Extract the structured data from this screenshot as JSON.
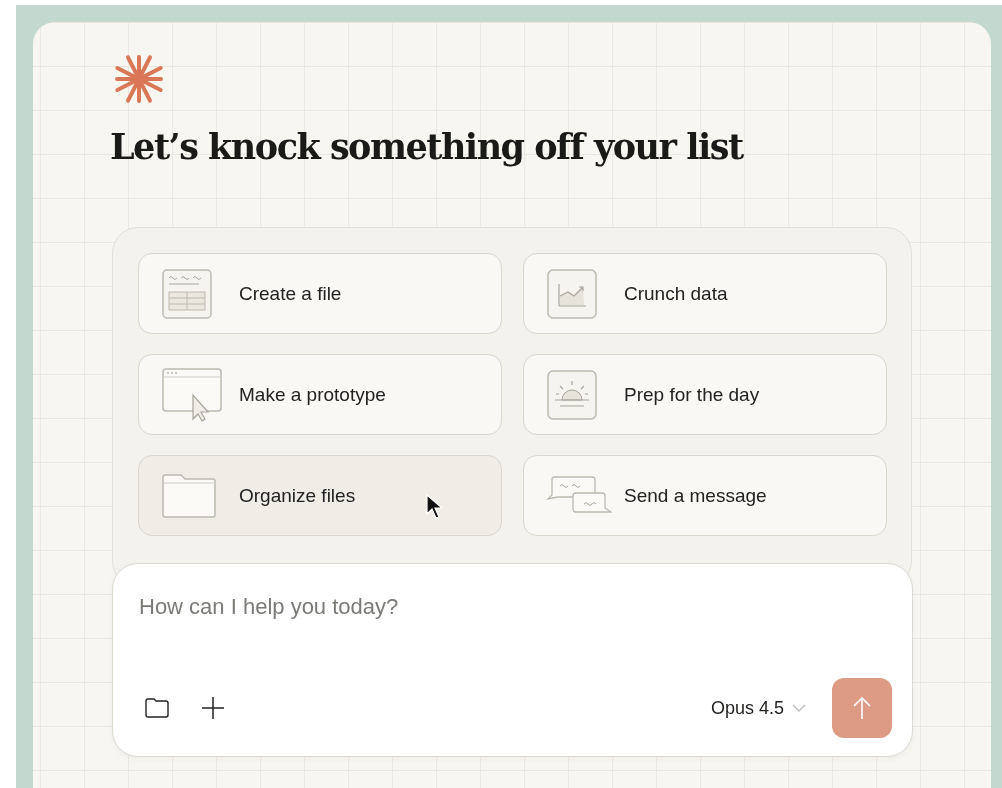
{
  "heading": "Let’s knock something off your list",
  "suggestions": [
    {
      "label": "Create a file",
      "kind": "table",
      "selected": false
    },
    {
      "label": "Crunch data",
      "kind": "chart",
      "selected": false
    },
    {
      "label": "Make a prototype",
      "kind": "browser",
      "selected": false
    },
    {
      "label": "Prep for the day",
      "kind": "sunrise",
      "selected": false
    },
    {
      "label": "Organize files",
      "kind": "folder",
      "selected": true
    },
    {
      "label": "Send a message",
      "kind": "chat",
      "selected": false
    }
  ],
  "composer": {
    "placeholder": "How can I help you today?",
    "model": "Opus 4.5"
  }
}
